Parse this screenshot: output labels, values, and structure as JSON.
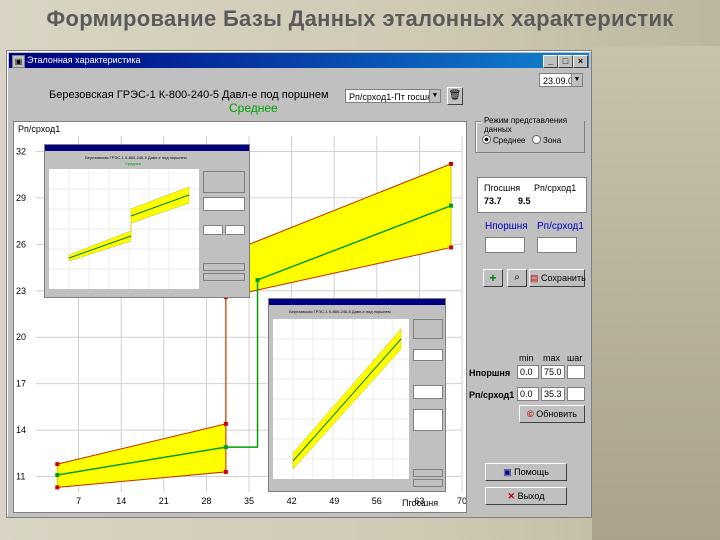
{
  "slide": {
    "title": "Формирование Базы Данных эталонных характеристик"
  },
  "window": {
    "title": "Эталонная характеристика",
    "controls": {
      "minimize": "_",
      "maximize": "□",
      "close": "×"
    },
    "date": "23.09.06"
  },
  "header": {
    "station": "Березовская ГРЭС-1  К-800-240-5 Давл-е под поршнем",
    "parameter_select": "Pп/срход1-Пт госшня",
    "mode": "Среднее"
  },
  "plot": {
    "ylabel": "Pп/срход1",
    "xlabel": "Пгосшня",
    "y_ticks": [
      "32",
      "29",
      "26",
      "23",
      "20",
      "17",
      "14",
      "11"
    ],
    "x_ticks": [
      "7",
      "14",
      "21",
      "28",
      "35",
      "42",
      "49",
      "56",
      "63",
      "70"
    ]
  },
  "chart_data": {
    "type": "line",
    "xlim": [
      0,
      70
    ],
    "ylim": [
      10,
      33
    ],
    "series": [
      {
        "points": [
          [
            3.5,
            11.1
          ],
          [
            31.2,
            12.9
          ]
        ]
      },
      {
        "points": [
          [
            36.4,
            23.7
          ],
          [
            68.2,
            28.5
          ]
        ]
      }
    ],
    "band_upper": [
      [
        3.5,
        11.8
      ],
      [
        31.2,
        14.4
      ],
      [
        31.2,
        25.4
      ],
      [
        68.2,
        31.2
      ]
    ],
    "band_lower": [
      [
        3.5,
        10.3
      ],
      [
        31.2,
        11.3
      ],
      [
        31.2,
        22.6
      ],
      [
        68.2,
        25.8
      ]
    ]
  },
  "panel": {
    "display_group": {
      "title": "Режим представления данных",
      "options": [
        {
          "label": "Среднее",
          "selected": true
        },
        {
          "label": "Зона",
          "selected": false
        }
      ]
    },
    "current": {
      "col1": "Пгосшня",
      "col2": "Pп/срход1",
      "val1": "73.7",
      "val2": "9.5"
    },
    "input_labels": {
      "a": "Нпоршня",
      "b": "Pп/срход1"
    },
    "input_values": {
      "a": "",
      "b": ""
    },
    "save_button": "Сохранить",
    "range_headers": {
      "min": "min",
      "max": "max",
      "step": "шаг"
    },
    "range_rows": [
      {
        "label": "Нпоршня",
        "min": "0.0",
        "max": "75.0",
        "step": ""
      },
      {
        "label": "Pп/срход1",
        "min": "0.0",
        "max": "35.3",
        "step": ""
      }
    ],
    "apply_button": "Обновить",
    "help_button": "Помощь",
    "exit_button": "Выход"
  },
  "thumbnails": [
    {
      "header": "Березовская ГРЭС-1 К-800-240-5 Давл-е под поршнем",
      "mode": "Среднее"
    },
    {
      "header": "Березовская ГРЭС-1 К-800-240-5 Давл-е под поршнем",
      "mode": ""
    }
  ],
  "colors": {
    "band": "#ffff00",
    "line": "#00a000",
    "marker": "#cc0000",
    "title_bar": "#000080"
  }
}
